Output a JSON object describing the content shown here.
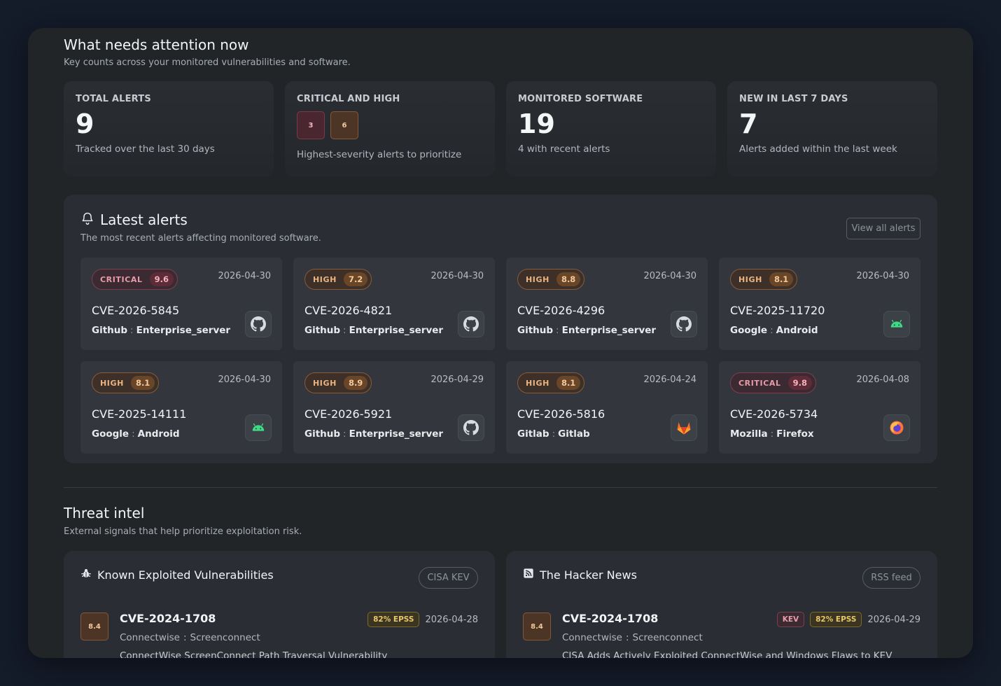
{
  "attention": {
    "title": "What needs attention now",
    "subtitle": "Key counts across your monitored vulnerabilities and software."
  },
  "stats": [
    {
      "label": "TOTAL ALERTS",
      "value": "9",
      "desc": "Tracked over the last 30 days"
    },
    {
      "label": "CRITICAL AND HIGH",
      "critical": "3",
      "high": "6",
      "desc": "Highest-severity alerts to prioritize"
    },
    {
      "label": "MONITORED SOFTWARE",
      "value": "19",
      "desc": "4 with recent alerts"
    },
    {
      "label": "NEW IN LAST 7 DAYS",
      "value": "7",
      "desc": "Alerts added within the last week"
    }
  ],
  "latest": {
    "title": "Latest alerts",
    "subtitle": "The most recent alerts affecting monitored software.",
    "view_all": "View all alerts",
    "alerts": [
      {
        "severity": "CRITICAL",
        "score": "9.6",
        "date": "2026-04-30",
        "cve": "CVE-2026-5845",
        "vendor": "Github",
        "product": "Enterprise_server",
        "logo": "github-icon"
      },
      {
        "severity": "HIGH",
        "score": "7.2",
        "date": "2026-04-30",
        "cve": "CVE-2026-4821",
        "vendor": "Github",
        "product": "Enterprise_server",
        "logo": "github-icon"
      },
      {
        "severity": "HIGH",
        "score": "8.8",
        "date": "2026-04-30",
        "cve": "CVE-2026-4296",
        "vendor": "Github",
        "product": "Enterprise_server",
        "logo": "github-icon"
      },
      {
        "severity": "HIGH",
        "score": "8.1",
        "date": "2026-04-30",
        "cve": "CVE-2025-11720",
        "vendor": "Google",
        "product": "Android",
        "logo": "android-icon"
      },
      {
        "severity": "HIGH",
        "score": "8.1",
        "date": "2026-04-30",
        "cve": "CVE-2025-14111",
        "vendor": "Google",
        "product": "Android",
        "logo": "android-icon"
      },
      {
        "severity": "HIGH",
        "score": "8.9",
        "date": "2026-04-29",
        "cve": "CVE-2026-5921",
        "vendor": "Github",
        "product": "Enterprise_server",
        "logo": "github-icon"
      },
      {
        "severity": "HIGH",
        "score": "8.1",
        "date": "2026-04-24",
        "cve": "CVE-2026-5816",
        "vendor": "Gitlab",
        "product": "Gitlab",
        "logo": "gitlab-icon"
      },
      {
        "severity": "CRITICAL",
        "score": "9.8",
        "date": "2026-04-08",
        "cve": "CVE-2026-5734",
        "vendor": "Mozilla",
        "product": "Firefox",
        "logo": "firefox-icon"
      }
    ]
  },
  "threat": {
    "title": "Threat intel",
    "subtitle": "External signals that help prioritize exploitation risk.",
    "kev": {
      "title": "Known Exploited Vulnerabilities",
      "button": "CISA KEV",
      "item": {
        "score": "8.4",
        "cve": "CVE-2024-1708",
        "epss": "82% EPSS",
        "date": "2026-04-28",
        "vendor": "Connectwise",
        "product": "Screenconnect",
        "desc": "ConnectWise ScreenConnect Path Traversal Vulnerability"
      }
    },
    "news": {
      "title": "The Hacker News",
      "button": "RSS feed",
      "item": {
        "score": "8.4",
        "cve": "CVE-2024-1708",
        "kev": "KEV",
        "epss": "82% EPSS",
        "date": "2026-04-29",
        "vendor": "Connectwise",
        "product": "Screenconnect",
        "desc": "CISA Adds Actively Exploited ConnectWise and Windows Flaws to KEV"
      }
    }
  },
  "colors": {
    "critical": "#e89ba8",
    "high": "#e9b482",
    "epss": "#e6c96a",
    "panel": "#2a2e34"
  }
}
